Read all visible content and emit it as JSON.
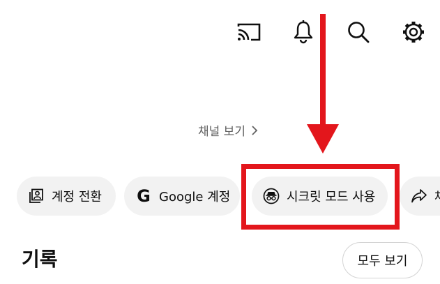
{
  "header": {
    "icons": [
      "cast-icon",
      "notifications-bell-icon",
      "search-icon",
      "settings-gear-icon"
    ]
  },
  "channel": {
    "view_channel_label": "채널 보기",
    "chevron": "›"
  },
  "chips": [
    {
      "label": "계정 전환",
      "icon": "switch-account-icon"
    },
    {
      "label": "Google 계정",
      "icon": "google-g-icon",
      "logo_text": "G"
    },
    {
      "label": "시크릿 모드 사용",
      "icon": "incognito-icon"
    },
    {
      "label": "채",
      "icon": "share-icon"
    }
  ],
  "history": {
    "title": "기록",
    "view_all_label": "모두 보기"
  },
  "annotation": {
    "color": "#e3161c"
  }
}
